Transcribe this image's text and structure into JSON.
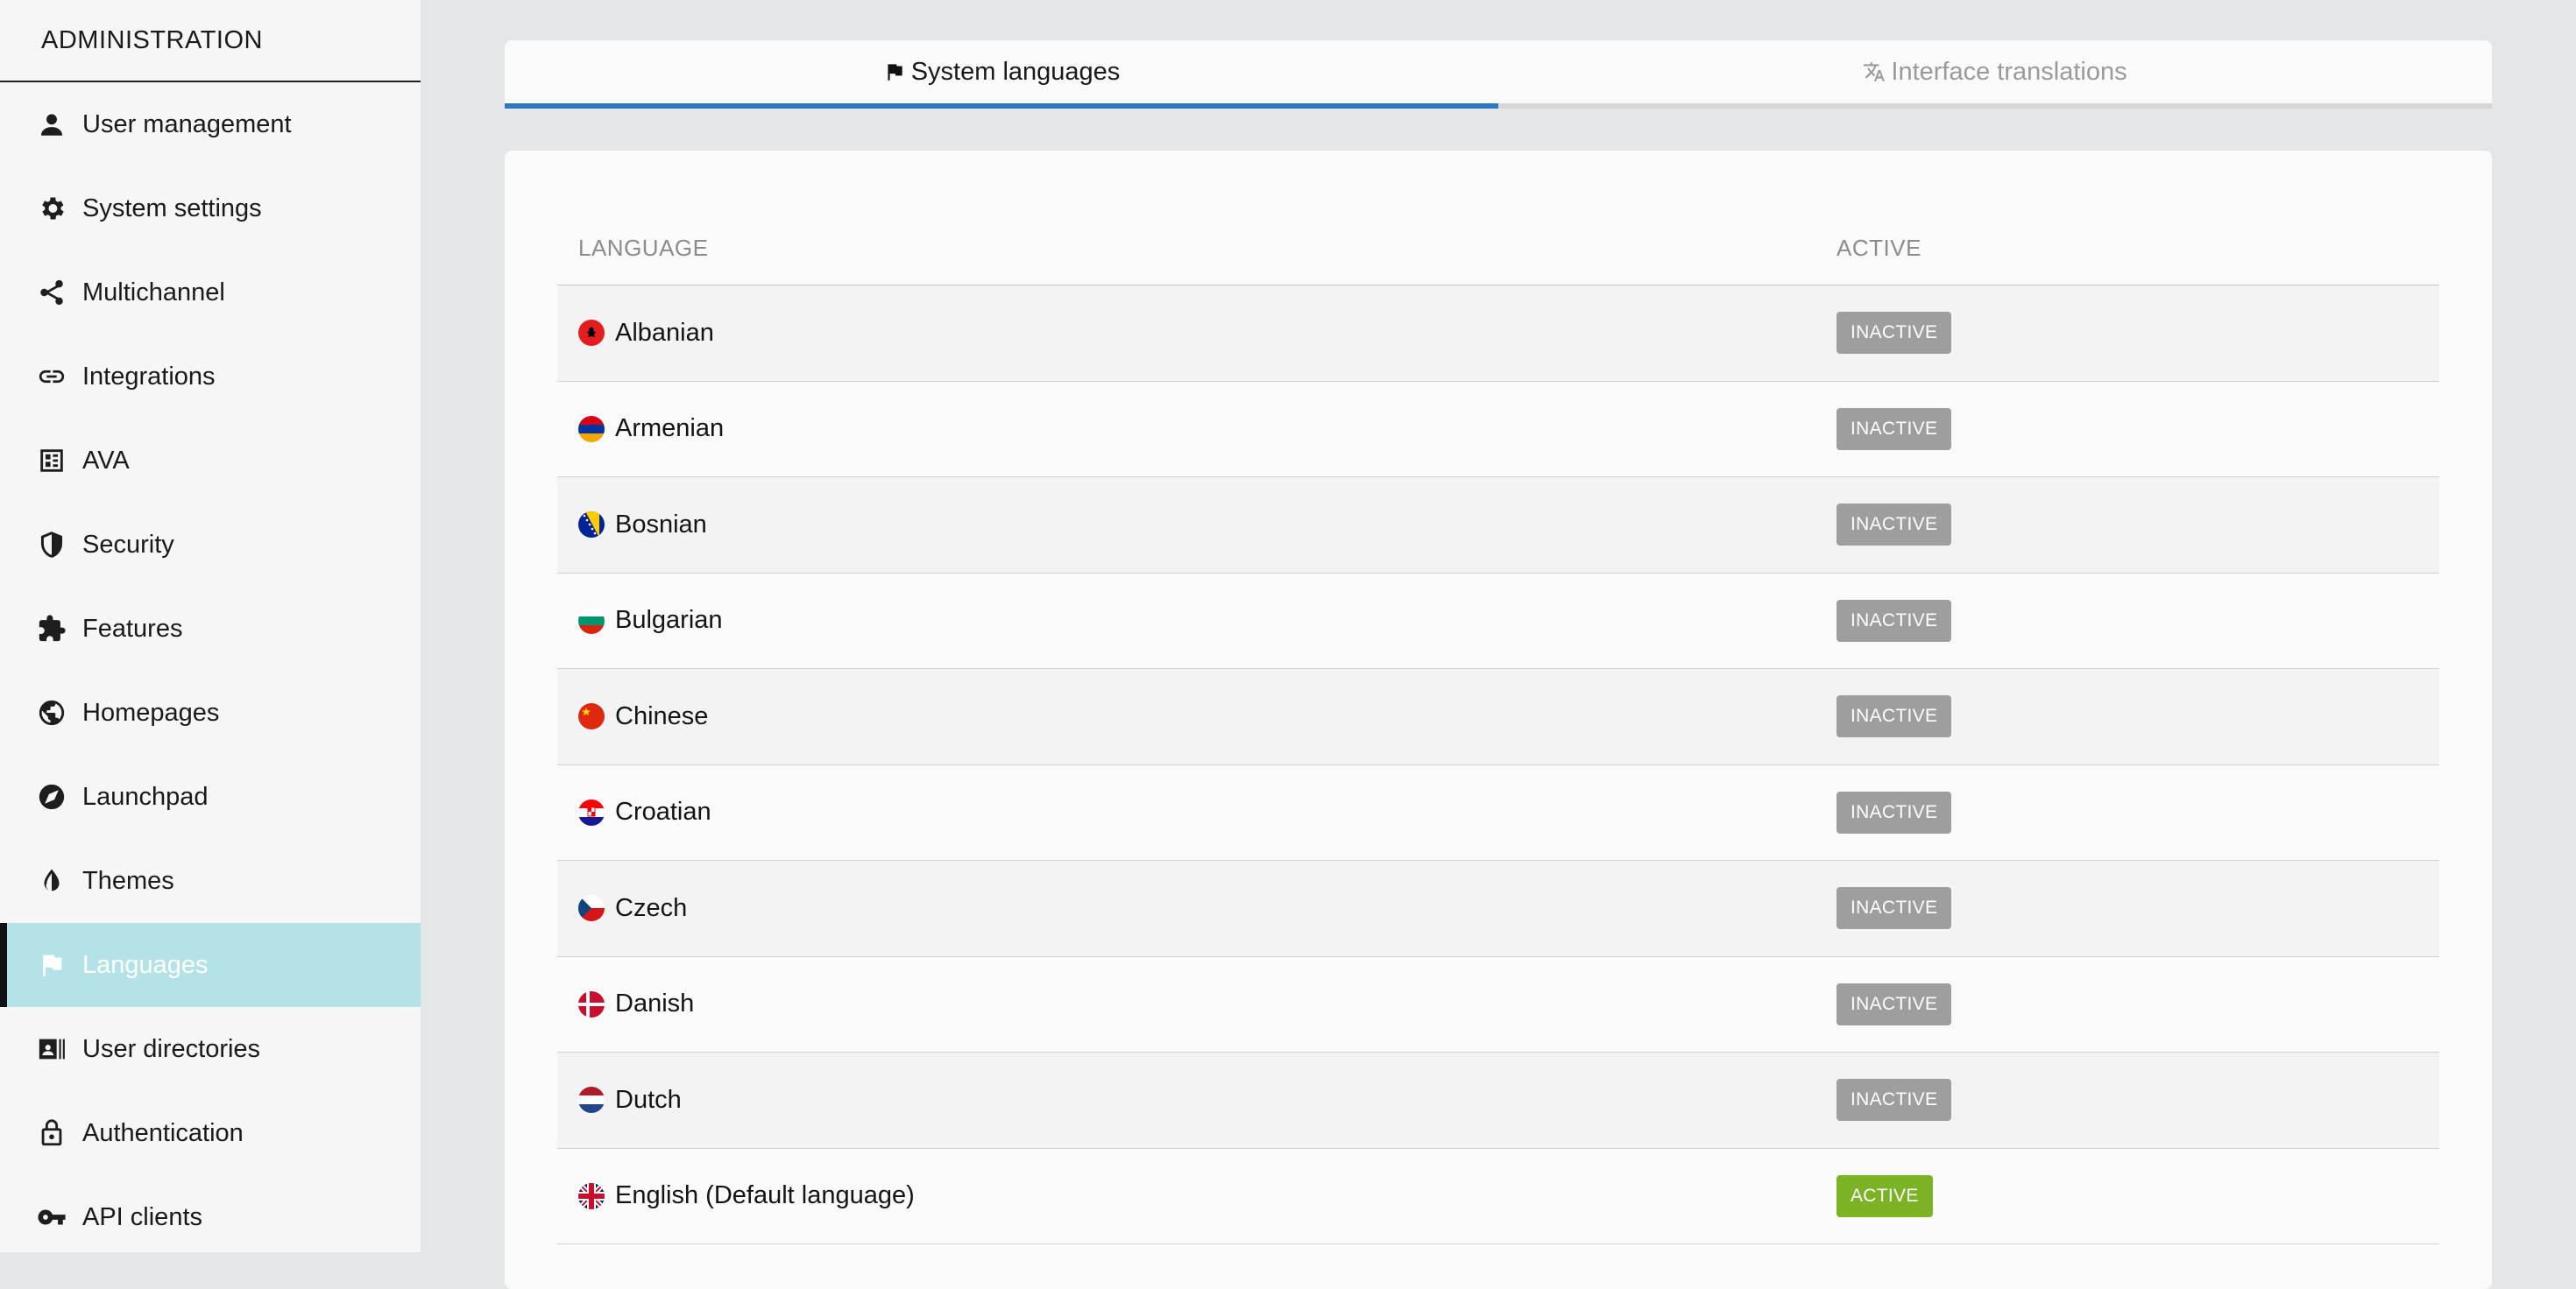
{
  "sidebar": {
    "title": "ADMINISTRATION",
    "items": [
      {
        "label": "User management",
        "icon": "person-icon"
      },
      {
        "label": "System settings",
        "icon": "gear-icon"
      },
      {
        "label": "Multichannel",
        "icon": "share-icon"
      },
      {
        "label": "Integrations",
        "icon": "link-icon"
      },
      {
        "label": "AVA",
        "icon": "dashboard-icon"
      },
      {
        "label": "Security",
        "icon": "shield-icon"
      },
      {
        "label": "Features",
        "icon": "puzzle-icon"
      },
      {
        "label": "Homepages",
        "icon": "globe-icon"
      },
      {
        "label": "Launchpad",
        "icon": "compass-icon"
      },
      {
        "label": "Themes",
        "icon": "contrast-icon"
      },
      {
        "label": "Languages",
        "icon": "flag-icon",
        "active": true
      },
      {
        "label": "User directories",
        "icon": "contact-card-icon"
      },
      {
        "label": "Authentication",
        "icon": "lock-icon"
      },
      {
        "label": "API clients",
        "icon": "key-icon"
      }
    ]
  },
  "tabs": [
    {
      "label": "System languages",
      "icon": "flag-icon",
      "active": true
    },
    {
      "label": "Interface translations",
      "icon": "translate-icon",
      "active": false
    }
  ],
  "table": {
    "headers": {
      "language": "LANGUAGE",
      "active": "ACTIVE"
    },
    "rows": [
      {
        "language": "Albanian",
        "status": "INACTIVE",
        "flag": "albania-flag-icon"
      },
      {
        "language": "Armenian",
        "status": "INACTIVE",
        "flag": "armenia-flag-icon"
      },
      {
        "language": "Bosnian",
        "status": "INACTIVE",
        "flag": "bosnia-flag-icon"
      },
      {
        "language": "Bulgarian",
        "status": "INACTIVE",
        "flag": "bulgaria-flag-icon"
      },
      {
        "language": "Chinese",
        "status": "INACTIVE",
        "flag": "china-flag-icon"
      },
      {
        "language": "Croatian",
        "status": "INACTIVE",
        "flag": "croatia-flag-icon"
      },
      {
        "language": "Czech",
        "status": "INACTIVE",
        "flag": "czech-flag-icon"
      },
      {
        "language": "Danish",
        "status": "INACTIVE",
        "flag": "denmark-flag-icon"
      },
      {
        "language": "Dutch",
        "status": "INACTIVE",
        "flag": "netherlands-flag-icon"
      },
      {
        "language": "English (Default language)",
        "status": "ACTIVE",
        "flag": "uk-flag-icon"
      }
    ]
  },
  "colors": {
    "active_nav_bg": "#b3e3e6",
    "tab_underline": "#2f76c0",
    "badge_inactive": "#9e9e9e",
    "badge_active": "#7bb324"
  }
}
